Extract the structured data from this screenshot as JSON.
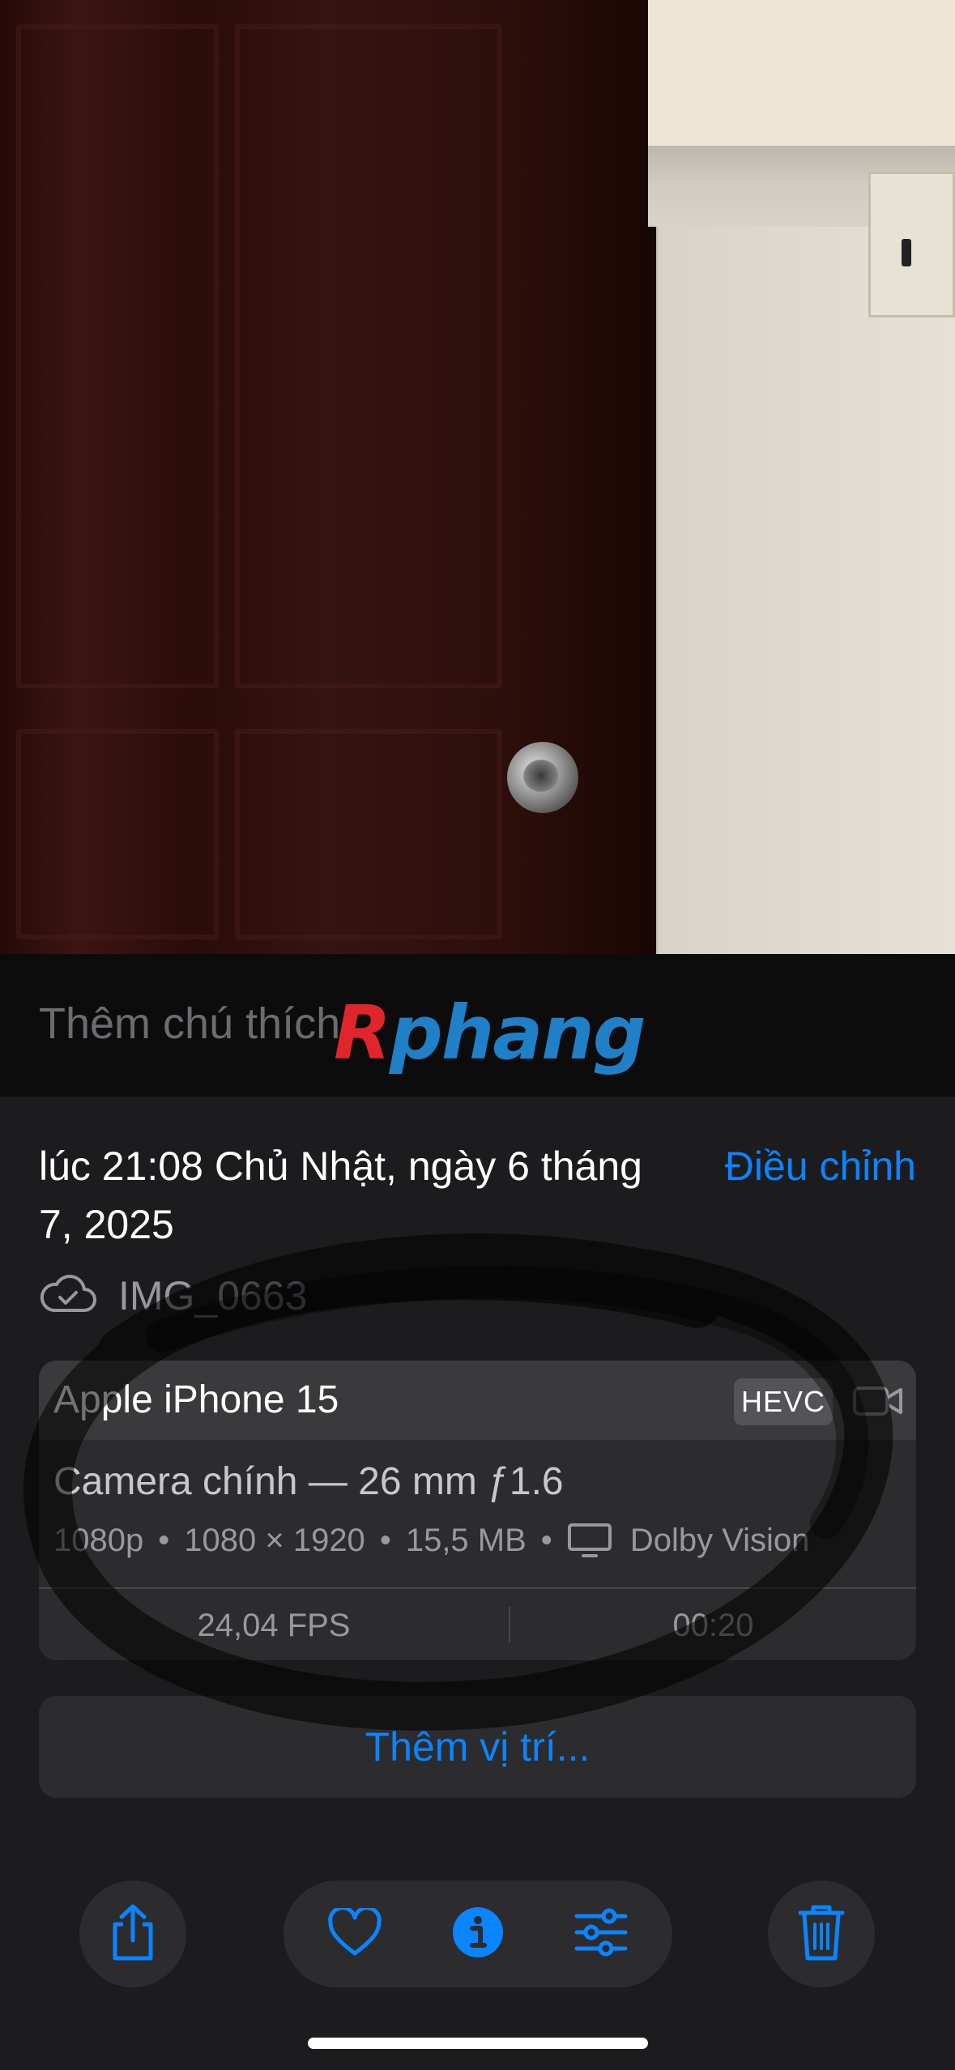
{
  "caption": {
    "placeholder": "Thêm chú thích",
    "watermark_first": "R",
    "watermark_rest": "phang"
  },
  "info": {
    "date_time": "lúc 21:08 Chủ Nhật, ngày 6 tháng 7, 2025",
    "adjust_label": "Điều chỉnh",
    "cloud_icon": "icloud-check-icon",
    "file_name": "IMG_0663"
  },
  "metadata": {
    "device": "Apple iPhone 15",
    "codec": "HEVC",
    "lens": "Camera chính — 26 mm ƒ1.6",
    "resolution_label": "1080p",
    "dimensions": "1080 × 1920",
    "file_size": "15,5 MB",
    "separator": "•",
    "hdr_format": "Dolby Vision",
    "fps": "24,04 FPS",
    "duration": "00:20"
  },
  "location": {
    "add_label": "Thêm vị trí..."
  },
  "toolbar": {
    "share_icon": "share-icon",
    "favorite_icon": "heart-icon",
    "info_icon": "info-icon",
    "edit_icon": "sliders-icon",
    "delete_icon": "trash-icon"
  },
  "colors": {
    "accent": "#0a84ff",
    "panel": "#1c1c1e",
    "card": "#2c2c2e"
  }
}
